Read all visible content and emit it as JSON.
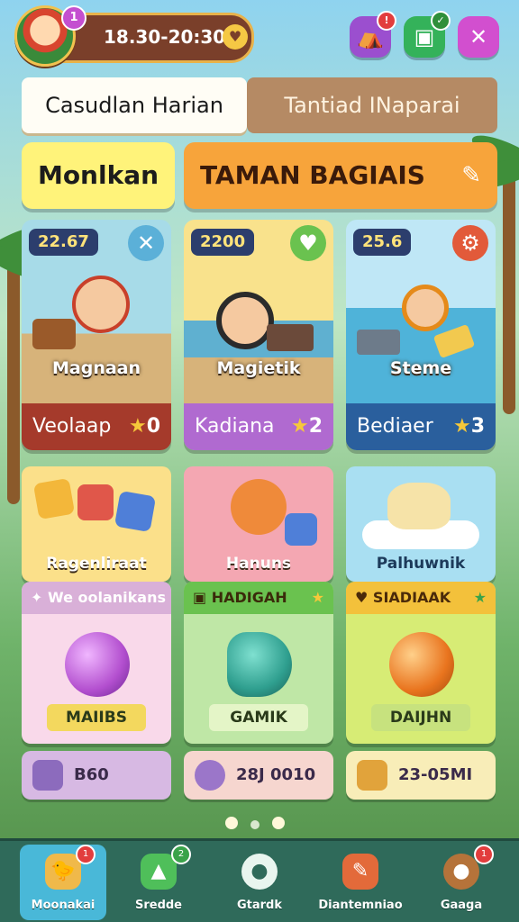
{
  "header": {
    "avatar_badge": "1",
    "timer": "18.30-20:30",
    "buttons": [
      {
        "name": "tent-button",
        "icon": "tent-icon",
        "color": "#9b4fcf"
      },
      {
        "name": "inbox-button",
        "icon": "inbox-icon",
        "color": "#34b25a"
      },
      {
        "name": "close-button",
        "icon": "close-icon",
        "color": "#d24fcf"
      }
    ]
  },
  "tabs": {
    "active": "Casudlan  Harian",
    "inactive": "Tantiad INaparai"
  },
  "sections": {
    "left_title": "Monlkan",
    "right_title": "TAMAN BAGIAIS"
  },
  "top_cards": [
    {
      "chip": "22.67",
      "name": "Magnaan",
      "foot": "Veolaap",
      "foot_value": "0",
      "scene": "#a7dbe8",
      "ground": "#d7b37a",
      "foot_color": "#a53a2b",
      "corner_color": "#5bb0d8"
    },
    {
      "chip": "2200",
      "name": "Magietik",
      "foot": "Kadiana",
      "foot_value": "2",
      "scene": "#f9e28c",
      "ground": "#5fb0d0",
      "foot_color": "#b06ad0",
      "corner_color": "#6ac24f"
    },
    {
      "chip": "25.6",
      "name": "Steme",
      "foot": "Bediaer",
      "foot_value": "3",
      "scene": "#bfe7f6",
      "ground": "#4fb3d9",
      "foot_color": "#2a5f9d",
      "corner_color": "#e25a3a"
    }
  ],
  "mid_cards": [
    {
      "label": "Ragenliraat",
      "color": "#fbe08a"
    },
    {
      "label": "Hanuns",
      "color": "#f4a7b2"
    },
    {
      "label": "Palhuwnik",
      "color": "#a9dff2"
    }
  ],
  "bottom_cards": [
    {
      "head": "We oolanikans",
      "pill": "MAIIBS",
      "head_color": "#d9b0d8",
      "body_color": "#f9d9ea",
      "orb_color": "#b34fcf",
      "pill_color": "#f3d85e"
    },
    {
      "head": "HADIGAH",
      "pill": "GAMIK",
      "head_color": "#6ac24f",
      "body_color": "#bfe7a6",
      "orb_color": "#2f9f8f",
      "pill_color": "#e4f5c7"
    },
    {
      "head": "SIADIAAK",
      "pill": "DAIJHN",
      "head_color": "#f3c13b",
      "body_color": "#d7ec75",
      "orb_color": "#e9741e",
      "pill_color": "#c7e27e"
    }
  ],
  "prices": [
    {
      "value": "B60",
      "color": "#d7b9e3",
      "icon": "#8c6bbd"
    },
    {
      "value": "28J 0010",
      "color": "#f6d6cf",
      "icon": "#9b76c9"
    },
    {
      "value": "23-05MI",
      "color": "#f8edb8",
      "icon": "#e1a33b"
    }
  ],
  "nav": [
    {
      "label": "Moonakai",
      "icon": "bird-icon",
      "badge": "1",
      "active": true,
      "color": "#f0b94a"
    },
    {
      "label": "Sredde",
      "icon": "map-icon",
      "badge": "2",
      "active": false,
      "color": "#4fbf5a"
    },
    {
      "label": "Gtardk",
      "icon": "speech-icon",
      "badge": "",
      "active": false,
      "color": "#e9f5ef"
    },
    {
      "label": "Diantemniao",
      "icon": "task-board-icon",
      "badge": "",
      "active": false,
      "color": "#e36a3a"
    },
    {
      "label": "Gaaga",
      "icon": "nut-icon",
      "badge": "1",
      "active": false,
      "color": "#b5733a"
    }
  ]
}
